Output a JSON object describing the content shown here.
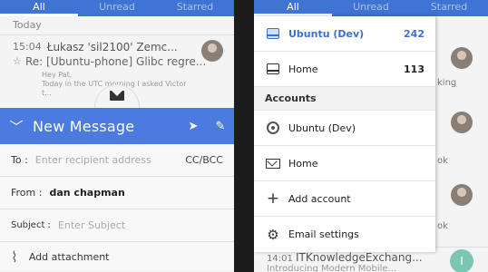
{
  "left": {
    "tabs": [
      "All",
      "Unread",
      "Starred"
    ],
    "section": "Today",
    "mail": {
      "time": "15:04",
      "from": "Łukasz 'sil2100' Zemc...",
      "subject": "Re: [Ubuntu-phone] Glibc regre...",
      "preview1": "Hey Pat,",
      "preview2": "Today in the UTC morning I asked Victor t..."
    },
    "compose": {
      "title": "New Message",
      "to_label": "To :",
      "to_placeholder": "Enter recipient address",
      "cc_label": "CC/BCC",
      "from_label": "From :",
      "from_value": "dan chapman",
      "subject_label": "Subject :",
      "subject_placeholder": "Enter Subject",
      "attach_label": "Add attachment"
    }
  },
  "right": {
    "tabs": [
      "All",
      "Unread",
      "Starred"
    ],
    "drawer": {
      "folders": [
        {
          "label": "Ubuntu (Dev)",
          "count": "242"
        },
        {
          "label": "Home",
          "count": "113"
        }
      ],
      "accounts_header": "Accounts",
      "accounts": [
        "Ubuntu (Dev)",
        "Home"
      ],
      "add_account": "Add account",
      "settings": "Email settings"
    },
    "bg_snippets": [
      "king",
      "ok",
      "ok"
    ],
    "bottom_mail": {
      "time": "14:01",
      "from": "ITKnowledgeExchang...",
      "preview": "Introducing Modern Mobile..."
    },
    "avatar_letter": "I"
  },
  "colors": {
    "header_blue": "#3f73d4",
    "compose_blue": "#4c7be0",
    "selected_blue": "#3b6fd1"
  }
}
